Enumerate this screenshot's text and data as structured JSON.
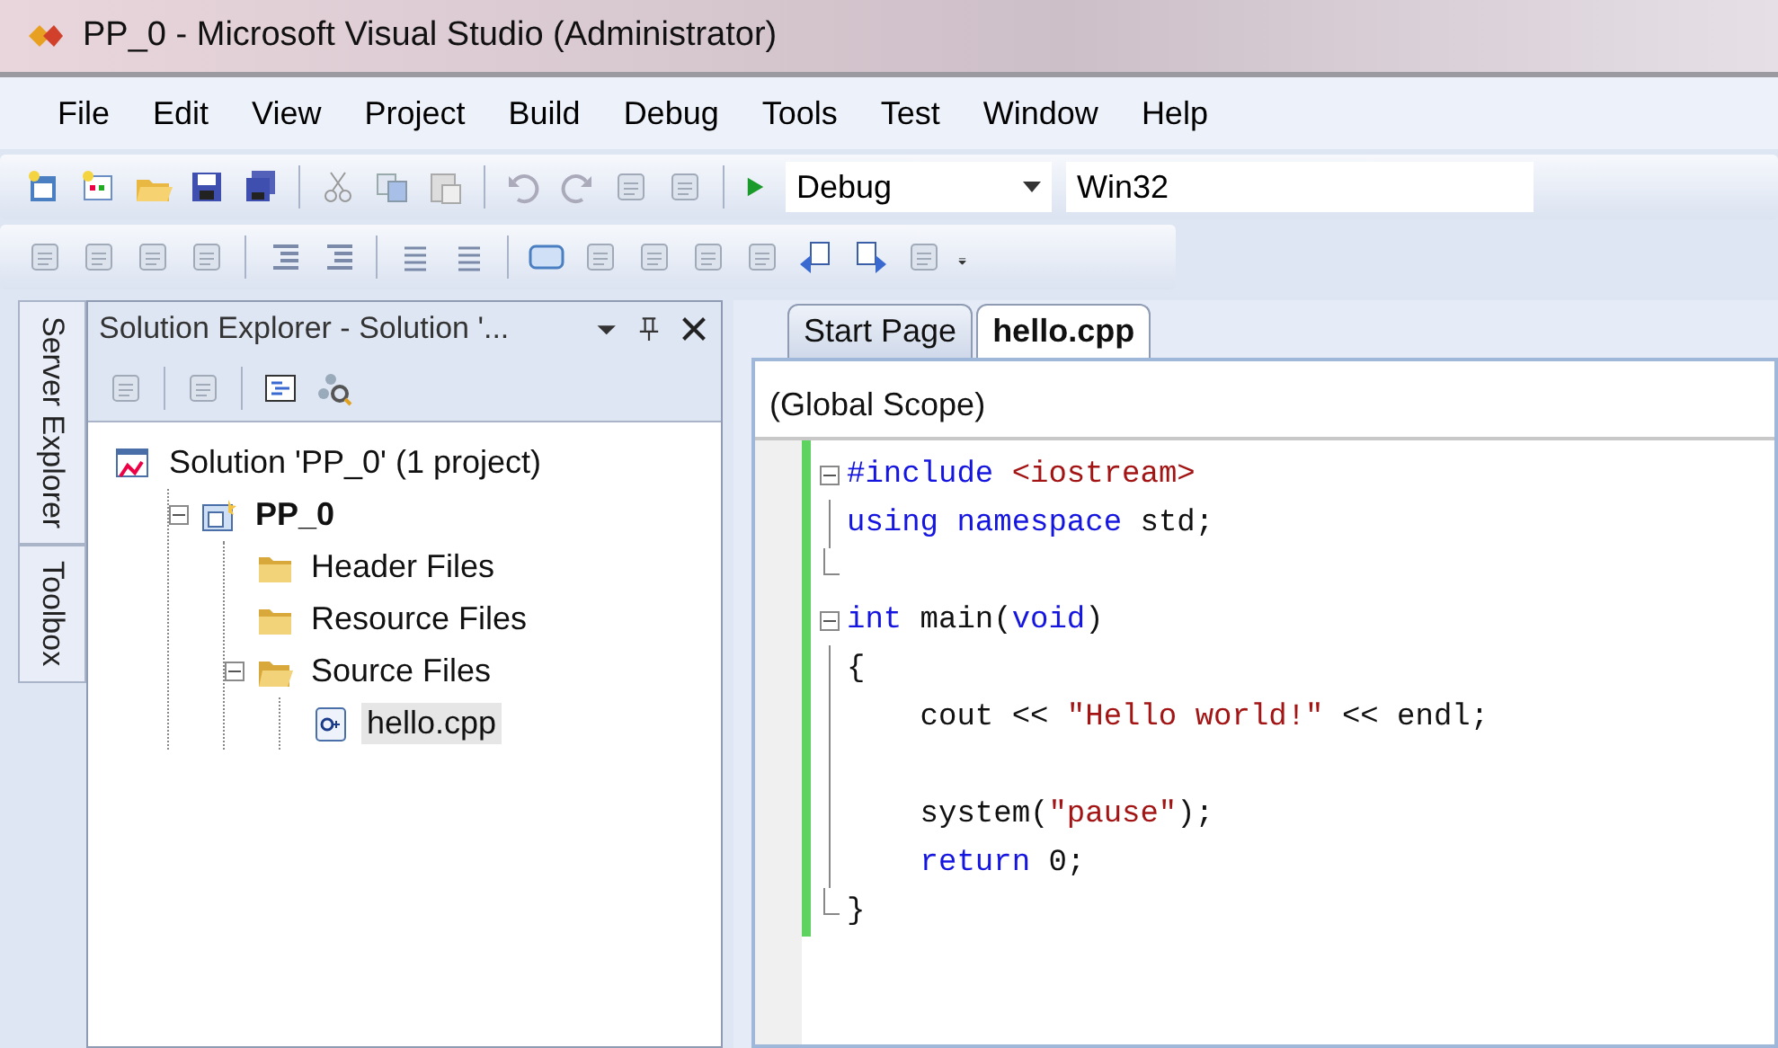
{
  "window": {
    "title": "PP_0 - Microsoft Visual Studio (Administrator)"
  },
  "menu": [
    "File",
    "Edit",
    "View",
    "Project",
    "Build",
    "Debug",
    "Tools",
    "Test",
    "Window",
    "Help"
  ],
  "toolbar": {
    "configuration": "Debug",
    "platform": "Win32"
  },
  "side_tabs": [
    "Server Explorer",
    "Toolbox"
  ],
  "solution_explorer": {
    "title": "Solution Explorer - Solution '...",
    "tree": [
      {
        "label": "Solution 'PP_0' (1 project)",
        "kind": "solution",
        "bold": false,
        "selected": false,
        "children": [
          {
            "label": "PP_0",
            "kind": "project",
            "bold": true,
            "selected": false,
            "expanded": true,
            "children": [
              {
                "label": "Header Files",
                "kind": "folder",
                "bold": false,
                "selected": false
              },
              {
                "label": "Resource Files",
                "kind": "folder",
                "bold": false,
                "selected": false
              },
              {
                "label": "Source Files",
                "kind": "folder",
                "bold": false,
                "selected": false,
                "expanded": true,
                "children": [
                  {
                    "label": "hello.cpp",
                    "kind": "cpp",
                    "bold": false,
                    "selected": true
                  }
                ]
              }
            ]
          }
        ]
      }
    ]
  },
  "editor": {
    "tabs": [
      {
        "label": "Start Page",
        "selected": false
      },
      {
        "label": "hello.cpp",
        "selected": true
      }
    ],
    "scope": "(Global Scope)",
    "lines": [
      {
        "fold_start": true,
        "fold_end": false,
        "tokens": [
          {
            "kind": "preprocessor",
            "text": "#include"
          },
          {
            "kind": "string",
            "text": " <iostream>"
          }
        ]
      },
      {
        "fold_start": false,
        "fold_end": false,
        "tokens": [
          {
            "kind": "keyword",
            "text": "using"
          },
          {
            "kind": "keyword",
            "text": " namespace"
          },
          {
            "kind": "plain",
            "text": " std;"
          }
        ]
      },
      {
        "fold_start": false,
        "fold_end": true
      },
      {
        "fold_start": true,
        "fold_end": false,
        "tokens": [
          {
            "kind": "keyword",
            "text": "int"
          },
          {
            "kind": "plain",
            "text": " main("
          },
          {
            "kind": "keyword",
            "text": "void"
          },
          {
            "kind": "plain",
            "text": ")"
          }
        ]
      },
      {
        "fold_start": false,
        "fold_end": false,
        "tokens": [
          {
            "kind": "plain",
            "text": "{"
          }
        ]
      },
      {
        "fold_start": false,
        "fold_end": false,
        "tokens": [
          {
            "kind": "plain",
            "text": "    cout << "
          },
          {
            "kind": "string",
            "text": "\"Hello world!\""
          },
          {
            "kind": "plain",
            "text": " << endl;"
          }
        ]
      },
      {
        "fold_start": false,
        "fold_end": false
      },
      {
        "fold_start": false,
        "fold_end": false,
        "tokens": [
          {
            "kind": "plain",
            "text": "    system("
          },
          {
            "kind": "string",
            "text": "\"pause\""
          },
          {
            "kind": "plain",
            "text": ");"
          }
        ]
      },
      {
        "fold_start": false,
        "fold_end": false,
        "tokens": [
          {
            "kind": "keyword",
            "text": "    return"
          },
          {
            "kind": "plain",
            "text": " 0;"
          }
        ]
      },
      {
        "fold_start": false,
        "fold_end": true,
        "tokens": [
          {
            "kind": "plain",
            "text": "}"
          }
        ]
      }
    ]
  }
}
